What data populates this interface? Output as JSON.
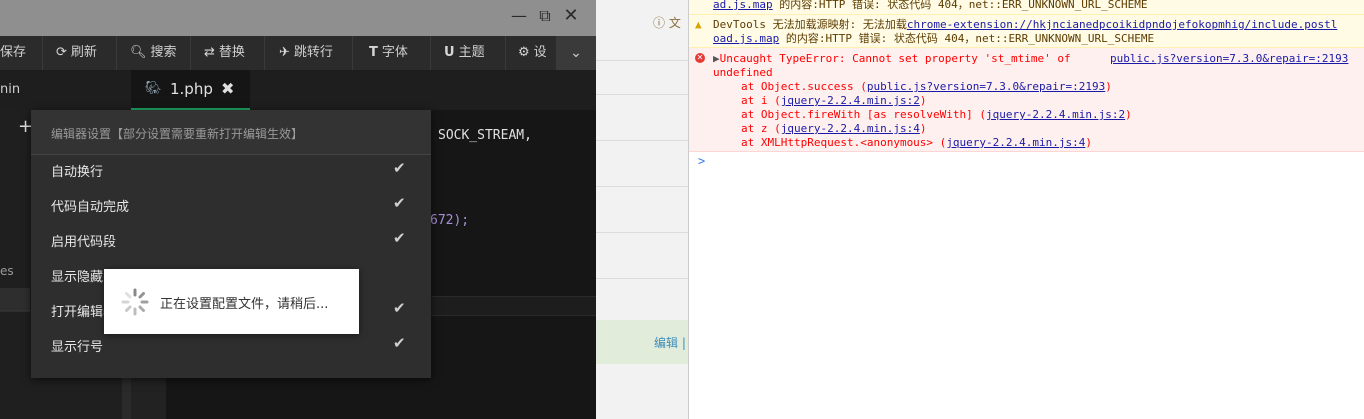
{
  "window": {
    "maximize_icon": "maximize-icon",
    "close_icon": "close-icon"
  },
  "toolbar": {
    "items": [
      {
        "label": "保存",
        "icon": ""
      },
      {
        "label": "刷新",
        "icon": "refresh-icon"
      },
      {
        "label": "搜索",
        "icon": "search-icon"
      },
      {
        "label": "替换",
        "icon": "replace-icon"
      },
      {
        "label": "跳转行",
        "icon": "goto-icon"
      },
      {
        "label": "字体",
        "icon": "font-icon"
      },
      {
        "label": "主题",
        "icon": "theme-icon"
      },
      {
        "label": "设",
        "icon": "gear-icon"
      }
    ],
    "more_icon": "chevron-down-icon"
  },
  "sidebar": {
    "title": "nin",
    "add_icon": "plus-icon",
    "item": "es"
  },
  "tab": {
    "label": "1.php",
    "close_icon": "close-icon"
  },
  "code": {
    "line1": "SOCK_STREAM,",
    "line2": "672);"
  },
  "settings": {
    "header": "编辑器设置【部分设置需要重新打开编辑生效】",
    "options": [
      {
        "label": "自动换行",
        "checked": true
      },
      {
        "label": "代码自动完成",
        "checked": true
      },
      {
        "label": "启用代码段",
        "checked": true
      },
      {
        "label": "显示隐藏字",
        "checked": false
      },
      {
        "label": "打开编辑器",
        "checked": true
      },
      {
        "label": "显示行号",
        "checked": true
      }
    ],
    "check_icon": "check-icon"
  },
  "toast": {
    "message": "正在设置配置文件，请稍后..."
  },
  "page": {
    "notice": "文",
    "edit": "编辑 |"
  },
  "console": {
    "warn1": {
      "link": "ad.js.map",
      "text": " 的内容:HTTP 错误: 状态代码 404，net::ERR_UNKNOWN_URL_SCHEME"
    },
    "warn2": {
      "prefix": "DevTools 无法加载源映射: 无法加载",
      "link_a": "chrome-extension://hkjncianedpcoikidpndojefokopmhig/include.postl",
      "link_b": "oad.js.map",
      "text": " 的内容:HTTP 错误: 状态代码 404，net::ERR_UNKNOWN_URL_SCHEME"
    },
    "error": {
      "title": "Uncaught TypeError: Cannot set property 'st_mtime' of",
      "title2": "undefined",
      "source": "public.js?version=7.3.0&repair=:2193",
      "stack": [
        {
          "pre": "at Object.success (",
          "link": "public.js?version=7.3.0&repair=:2193",
          "post": ")"
        },
        {
          "pre": "at i (",
          "link": "jquery-2.2.4.min.js:2",
          "post": ")"
        },
        {
          "pre": "at Object.fireWith [as resolveWith] (",
          "link": "jquery-2.2.4.min.js:2",
          "post": ")"
        },
        {
          "pre": "at z (",
          "link": "jquery-2.2.4.min.js:4",
          "post": ")"
        },
        {
          "pre": "at XMLHttpRequest.<anonymous> (",
          "link": "jquery-2.2.4.min.js:4",
          "post": ")"
        }
      ]
    },
    "prompt": ">"
  }
}
